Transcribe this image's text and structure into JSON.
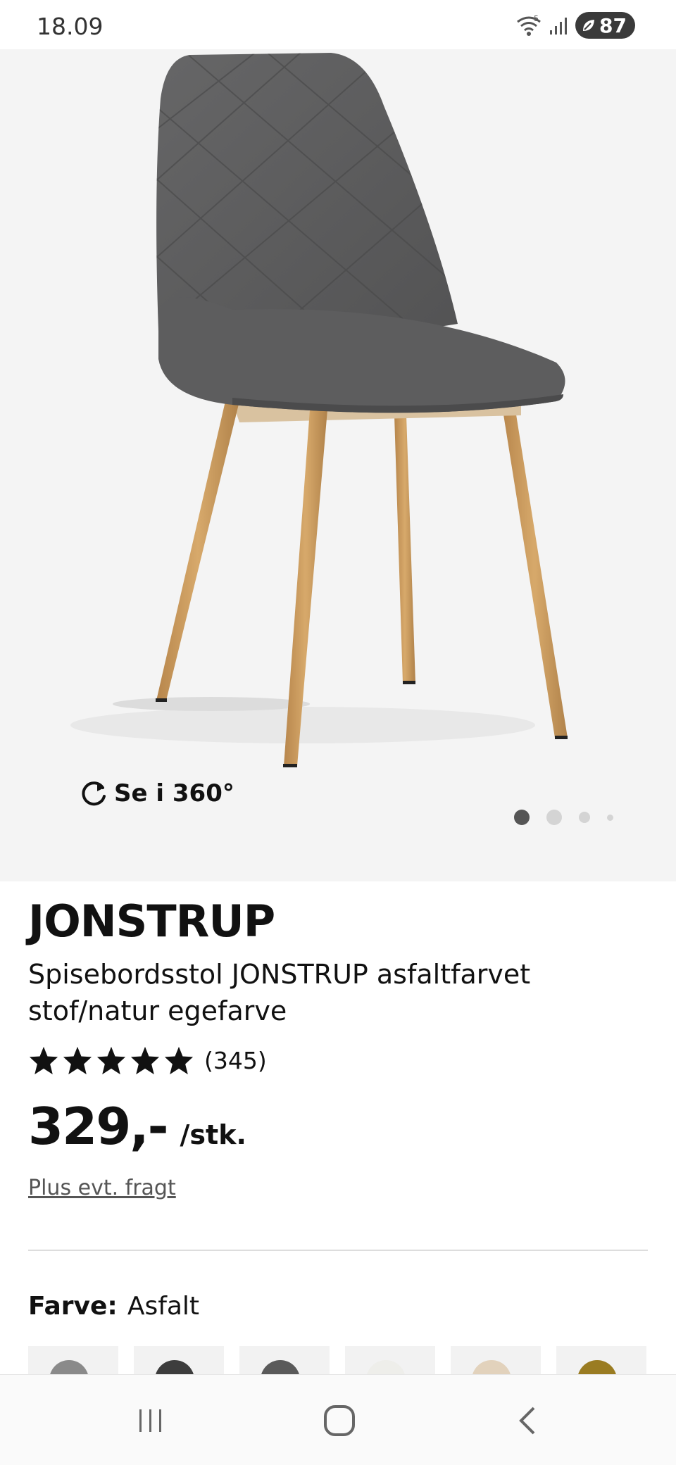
{
  "status_bar": {
    "time": "18.09",
    "battery": "87"
  },
  "gallery": {
    "rotate_label": "Se i 360°",
    "page_count": 4,
    "active_page": 1
  },
  "product": {
    "brand": "JONSTRUP",
    "description": "Spisebordsstol JONSTRUP asfaltfarvet stof/natur egefarve",
    "rating": 5,
    "review_count": "(345)",
    "price": "329,-",
    "unit": "/stk.",
    "shipping_note": "Plus evt. fragt"
  },
  "color": {
    "label": "Farve:",
    "selected": "Asfalt",
    "swatch_colors": [
      "#8a8a8a",
      "#3d3d3d",
      "#5a5a5a",
      "#eeeeea",
      "#e2d2bc",
      "#9a7c22"
    ]
  },
  "colors": {
    "chair_fabric": "#5b5b5c",
    "chair_legs": "#c99a5e",
    "hero_bg": "#f4f4f4"
  }
}
